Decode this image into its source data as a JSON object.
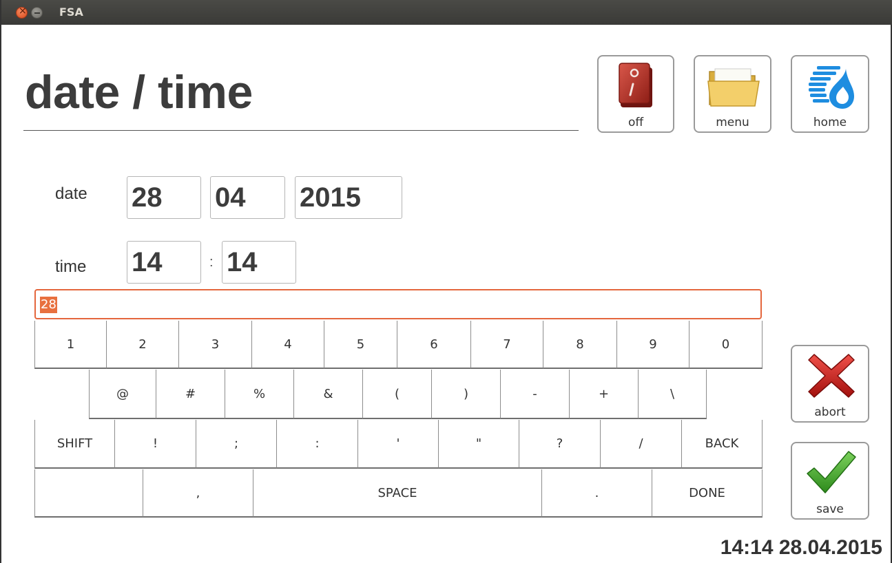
{
  "window": {
    "title": "FSA"
  },
  "page": {
    "title": "date / time"
  },
  "toolbar": {
    "off_label": "off",
    "menu_label": "menu",
    "home_label": "home"
  },
  "form": {
    "date_label": "date",
    "day": "28",
    "month": "04",
    "year": "2015",
    "time_label": "time",
    "hour": "14",
    "separator": ":",
    "minute": "14"
  },
  "input": {
    "value": "28"
  },
  "keyboard": {
    "row1": [
      "1",
      "2",
      "3",
      "4",
      "5",
      "6",
      "7",
      "8",
      "9",
      "0"
    ],
    "row2": [
      "@",
      "#",
      "%",
      "&",
      "(",
      ")",
      "-",
      "+",
      "\\"
    ],
    "row3": [
      "SHIFT",
      "!",
      ";",
      ":",
      "'",
      "\"",
      "?",
      "/",
      "BACK"
    ],
    "row4": [
      "",
      ",",
      "SPACE",
      ".",
      "DONE"
    ]
  },
  "actions": {
    "abort_label": "abort",
    "save_label": "save"
  },
  "status": {
    "datetime": "14:14 28.04.2015"
  },
  "colors": {
    "accent": "#e4663c",
    "abort": "#c8201e",
    "save": "#3fa32a"
  },
  "icons": {
    "off": "power-switch-icon",
    "menu": "folder-icon",
    "home": "drop-logo-icon",
    "abort": "x-icon",
    "save": "checkmark-icon"
  }
}
